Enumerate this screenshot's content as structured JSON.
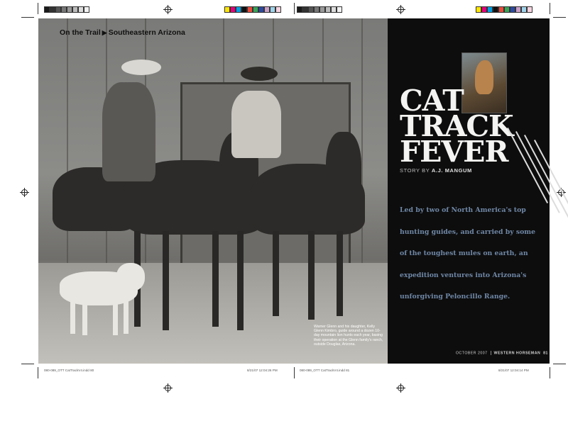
{
  "kicker": {
    "section": "On the Trail",
    "separator": "▶",
    "location": "Southeastern Arizona"
  },
  "title": {
    "line1": "CAT",
    "line2": "TRACK",
    "line3": "FEVER"
  },
  "byline": {
    "prefix": "STORY BY",
    "author": "A.J. MANGUM"
  },
  "deck": {
    "lines": [
      "Led by two of North America's top",
      "hunting guides, and carried by some",
      "of the toughest mules on earth, an",
      "expedition ventures into Arizona's",
      "unforgiving Peloncillo Range."
    ]
  },
  "caption": "Warner Glenn and his daughter, Kelly Glenn Kimbro, guide around a dozen 10-day mountain lion hunts each year, basing their operation at the Glenn family's ranch, outside Douglas, Arizona.",
  "folio": {
    "date": "OCTOBER 2007",
    "magazine": "WESTERN HORSEMAN",
    "page": "81"
  },
  "slugs": {
    "left": "080-089_OTT CatTrackV4.indd 80",
    "left_time": "8/21/07 12:04:26 PM",
    "right": "080-089_OTT CatTrackV4.indd 81",
    "right_time": "8/21/07 12:04:14 PM"
  },
  "colors": {
    "background_panel": "#0d0d0d",
    "deck_text": "#6f87a6",
    "title_text": "#f4f4f2"
  },
  "colorbar_swatches": [
    "#1a1a1a",
    "#333333",
    "#555555",
    "#777777",
    "#999999",
    "#bbbbbb",
    "#dddddd",
    "#f2f2f2"
  ],
  "colorbar_color_swatches": [
    "#ffe600",
    "#e2007a",
    "#00a0e3",
    "#111111",
    "#e84c3d",
    "#3aa457",
    "#2d4aa0",
    "#c9a0c8",
    "#9fd3ea",
    "#f5d4e0"
  ]
}
